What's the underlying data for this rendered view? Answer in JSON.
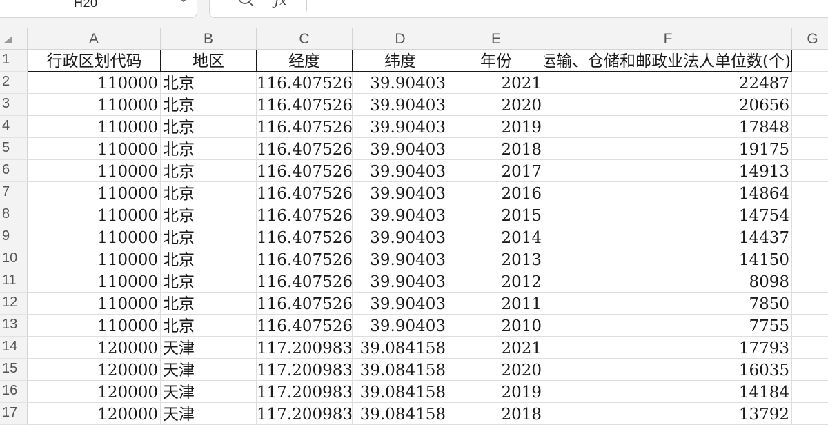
{
  "formula_bar": {
    "cell_ref": "H20",
    "formula_icon": "fx-icon",
    "zoom_icon": "zoom-magnifier-icon",
    "dropdown_icon": "chevron-down-icon"
  },
  "columns": [
    "A",
    "B",
    "C",
    "D",
    "E",
    "F",
    "G"
  ],
  "header_row": {
    "row_number": "1",
    "cells": [
      "行政区划代码",
      "地区",
      "经度",
      "纬度",
      "年份",
      "运输、仓储和邮政业法人单位数(个)"
    ]
  },
  "rows": [
    {
      "n": "2",
      "cells": [
        "110000",
        "北京",
        "116.407526",
        "39.90403",
        "2021",
        "22487"
      ]
    },
    {
      "n": "3",
      "cells": [
        "110000",
        "北京",
        "116.407526",
        "39.90403",
        "2020",
        "20656"
      ]
    },
    {
      "n": "4",
      "cells": [
        "110000",
        "北京",
        "116.407526",
        "39.90403",
        "2019",
        "17848"
      ]
    },
    {
      "n": "5",
      "cells": [
        "110000",
        "北京",
        "116.407526",
        "39.90403",
        "2018",
        "19175"
      ]
    },
    {
      "n": "6",
      "cells": [
        "110000",
        "北京",
        "116.407526",
        "39.90403",
        "2017",
        "14913"
      ]
    },
    {
      "n": "7",
      "cells": [
        "110000",
        "北京",
        "116.407526",
        "39.90403",
        "2016",
        "14864"
      ]
    },
    {
      "n": "8",
      "cells": [
        "110000",
        "北京",
        "116.407526",
        "39.90403",
        "2015",
        "14754"
      ]
    },
    {
      "n": "9",
      "cells": [
        "110000",
        "北京",
        "116.407526",
        "39.90403",
        "2014",
        "14437"
      ]
    },
    {
      "n": "10",
      "cells": [
        "110000",
        "北京",
        "116.407526",
        "39.90403",
        "2013",
        "14150"
      ]
    },
    {
      "n": "11",
      "cells": [
        "110000",
        "北京",
        "116.407526",
        "39.90403",
        "2012",
        "8098"
      ]
    },
    {
      "n": "12",
      "cells": [
        "110000",
        "北京",
        "116.407526",
        "39.90403",
        "2011",
        "7850"
      ]
    },
    {
      "n": "13",
      "cells": [
        "110000",
        "北京",
        "116.407526",
        "39.90403",
        "2010",
        "7755"
      ]
    },
    {
      "n": "14",
      "cells": [
        "120000",
        "天津",
        "117.200983",
        "39.084158",
        "2021",
        "17793"
      ]
    },
    {
      "n": "15",
      "cells": [
        "120000",
        "天津",
        "117.200983",
        "39.084158",
        "2020",
        "16035"
      ]
    },
    {
      "n": "16",
      "cells": [
        "120000",
        "天津",
        "117.200983",
        "39.084158",
        "2019",
        "14184"
      ]
    },
    {
      "n": "17",
      "cells": [
        "120000",
        "天津",
        "117.200983",
        "39.084158",
        "2018",
        "13792"
      ]
    }
  ]
}
